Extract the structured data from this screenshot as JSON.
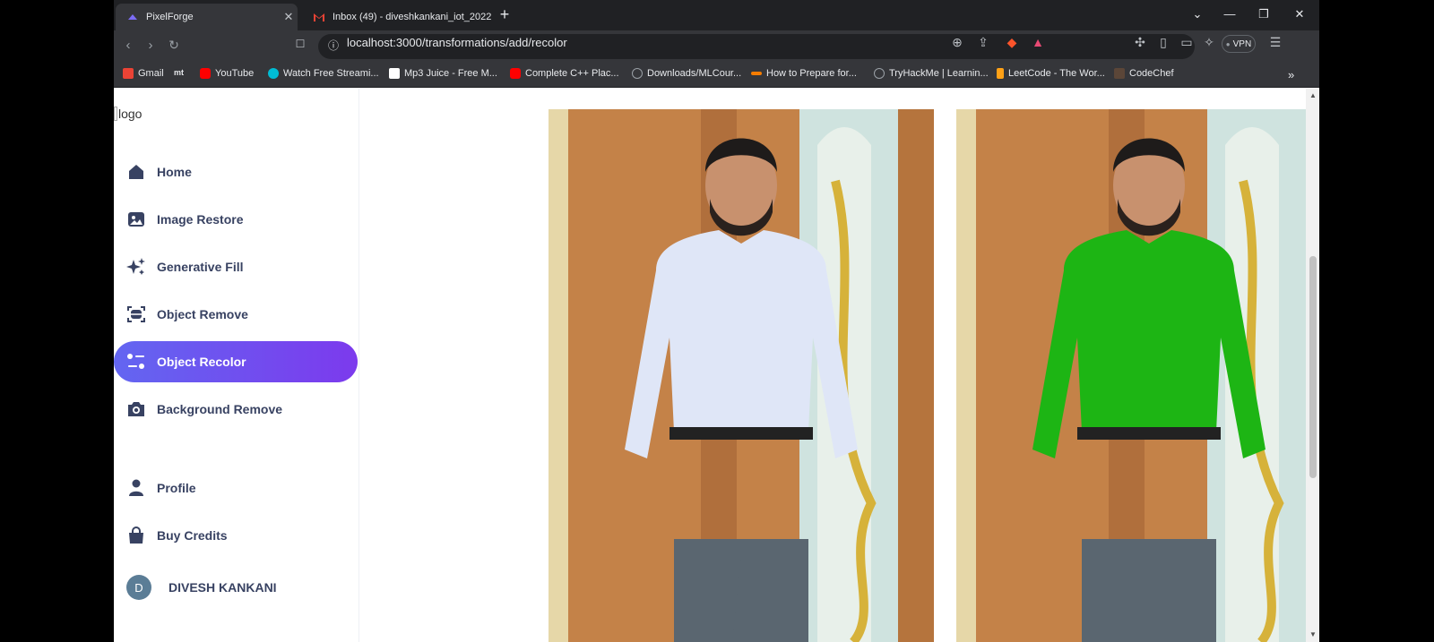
{
  "browser": {
    "tabs": [
      {
        "title": "PixelForge",
        "active": true
      },
      {
        "title": "Inbox (49) - diveshkankani_iot_2022",
        "active": false
      }
    ],
    "url": "localhost:3000/transformations/add/recolor",
    "vpn_label": "VPN",
    "bookmarks": [
      {
        "label": "Gmail",
        "color": "#ea4335"
      },
      {
        "label": "",
        "color": "#ffffff"
      },
      {
        "label": "YouTube",
        "color": "#ff0000"
      },
      {
        "label": "Watch Free Streami...",
        "color": "#00bcd4"
      },
      {
        "label": "Mp3 Juice - Free M...",
        "color": "#ffffff"
      },
      {
        "label": "Complete C++ Plac...",
        "color": "#ff0000"
      },
      {
        "label": "Downloads/MLCour...",
        "color": "#9aa0a6"
      },
      {
        "label": "How to Prepare for...",
        "color": "#f57c00"
      },
      {
        "label": "TryHackMe | Learnin...",
        "color": "#9aa0a6"
      },
      {
        "label": "LeetCode - The Wor...",
        "color": "#ffa116"
      },
      {
        "label": "CodeChef",
        "color": "#5b4638"
      }
    ]
  },
  "sidebar": {
    "logo_alt": "logo",
    "items": [
      {
        "label": "Home",
        "icon": "home-icon"
      },
      {
        "label": "Image Restore",
        "icon": "image-icon"
      },
      {
        "label": "Generative Fill",
        "icon": "stars-icon"
      },
      {
        "label": "Object Remove",
        "icon": "scan-icon"
      },
      {
        "label": "Object Recolor",
        "icon": "filter-icon",
        "active": true
      },
      {
        "label": "Background Remove",
        "icon": "camera-icon"
      }
    ],
    "bottom_items": [
      {
        "label": "Profile",
        "icon": "user-icon"
      },
      {
        "label": "Buy Credits",
        "icon": "bag-icon"
      }
    ],
    "user": {
      "initial": "D",
      "name": "DIVESH KANKANI"
    }
  },
  "content": {
    "original_image": {
      "shirt_color": "#dfe6f7"
    },
    "transformed_image": {
      "shirt_color": "#1db514"
    }
  },
  "colors": {
    "accent": "#6366f1",
    "nav_text": "#384262"
  }
}
